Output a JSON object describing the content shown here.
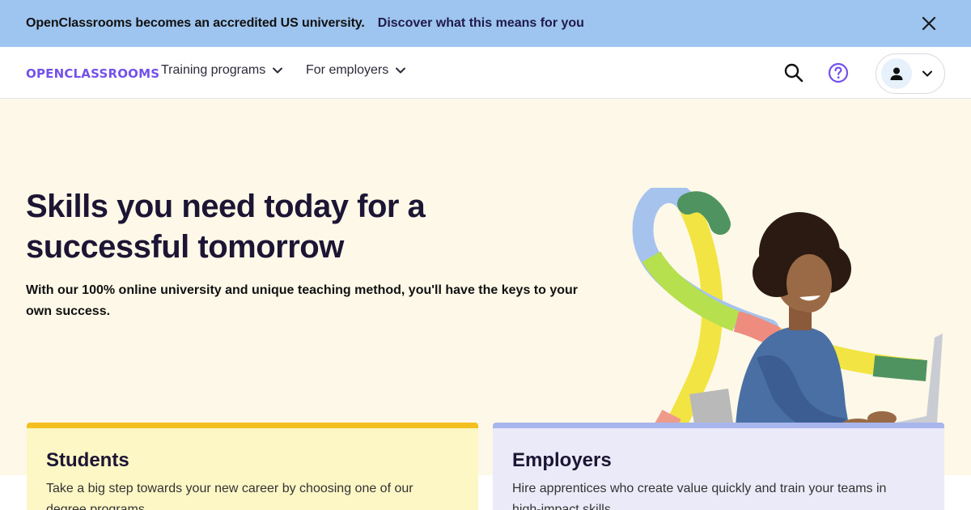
{
  "banner": {
    "text": "OpenClassrooms becomes an accredited US university.",
    "link": "Discover what this means for you",
    "close_icon": "close-icon"
  },
  "nav": {
    "logo": "OPENCLASSROOMS",
    "items": [
      {
        "label": "Training programs",
        "icon": "chevron-down-icon"
      },
      {
        "label": "For employers",
        "icon": "chevron-down-icon"
      }
    ],
    "icons": [
      "search-icon",
      "help-icon",
      "user-icon",
      "chevron-down-icon"
    ]
  },
  "hero": {
    "title": "Skills you need today for a successful tomorrow",
    "subtitle": "With our 100% online university and unique teaching method, you'll have the keys to your own success."
  },
  "cards": [
    {
      "title": "Students",
      "text": "Take a big step towards your new career by choosing one of our degree programs."
    },
    {
      "title": "Employers",
      "text": "Hire apprentices who create value quickly and train your teams in high-impact skills."
    }
  ],
  "colors": {
    "banner_bg": "#9ec5f0",
    "hero_bg": "#fdf8e8",
    "brand_purple": "#7451eb",
    "students_card": "#fdf7c6",
    "employers_card": "#eaeaf8"
  }
}
